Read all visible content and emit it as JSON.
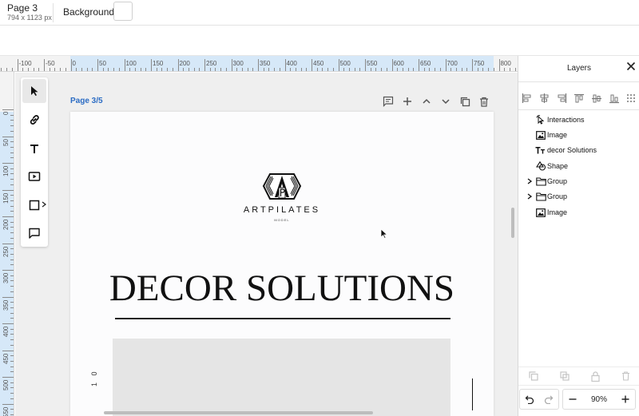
{
  "topbar": {
    "page_name": "Page 3",
    "page_size": "794 x 1123 px",
    "background_label": "Background"
  },
  "ruler": {
    "h_labels": [
      "50",
      "-100",
      "-50",
      "0",
      "50",
      "100",
      "150",
      "200",
      "250",
      "300",
      "350",
      "400",
      "450",
      "500",
      "550",
      "600",
      "650",
      "700",
      "750",
      "800"
    ],
    "v_labels": [
      "0",
      "50",
      "100",
      "150",
      "200",
      "250",
      "300",
      "350",
      "400",
      "450",
      "500",
      "550"
    ]
  },
  "tools": {
    "items": [
      "select",
      "link",
      "text",
      "media",
      "shape",
      "comment"
    ]
  },
  "canvas": {
    "page_label": "Page 3/5",
    "brand": "ARTPILATES",
    "brand_sub": "MODEL",
    "headline": "DECOR SOLUTIONS",
    "side_number": "1 0"
  },
  "layers": {
    "title": "Layers",
    "items": [
      {
        "name": "Interactions",
        "icon": "interactions-icon",
        "expandable": false
      },
      {
        "name": "Image",
        "icon": "image-icon",
        "expandable": false
      },
      {
        "name": "decor Solutions",
        "icon": "text-icon",
        "expandable": false
      },
      {
        "name": "Shape",
        "icon": "shape-icon",
        "expandable": false
      },
      {
        "name": "Group",
        "icon": "folder-icon",
        "expandable": true
      },
      {
        "name": "Group",
        "icon": "folder-icon",
        "expandable": true
      },
      {
        "name": "Image",
        "icon": "image-icon",
        "expandable": false
      }
    ]
  },
  "zoom": {
    "value": "90%"
  }
}
